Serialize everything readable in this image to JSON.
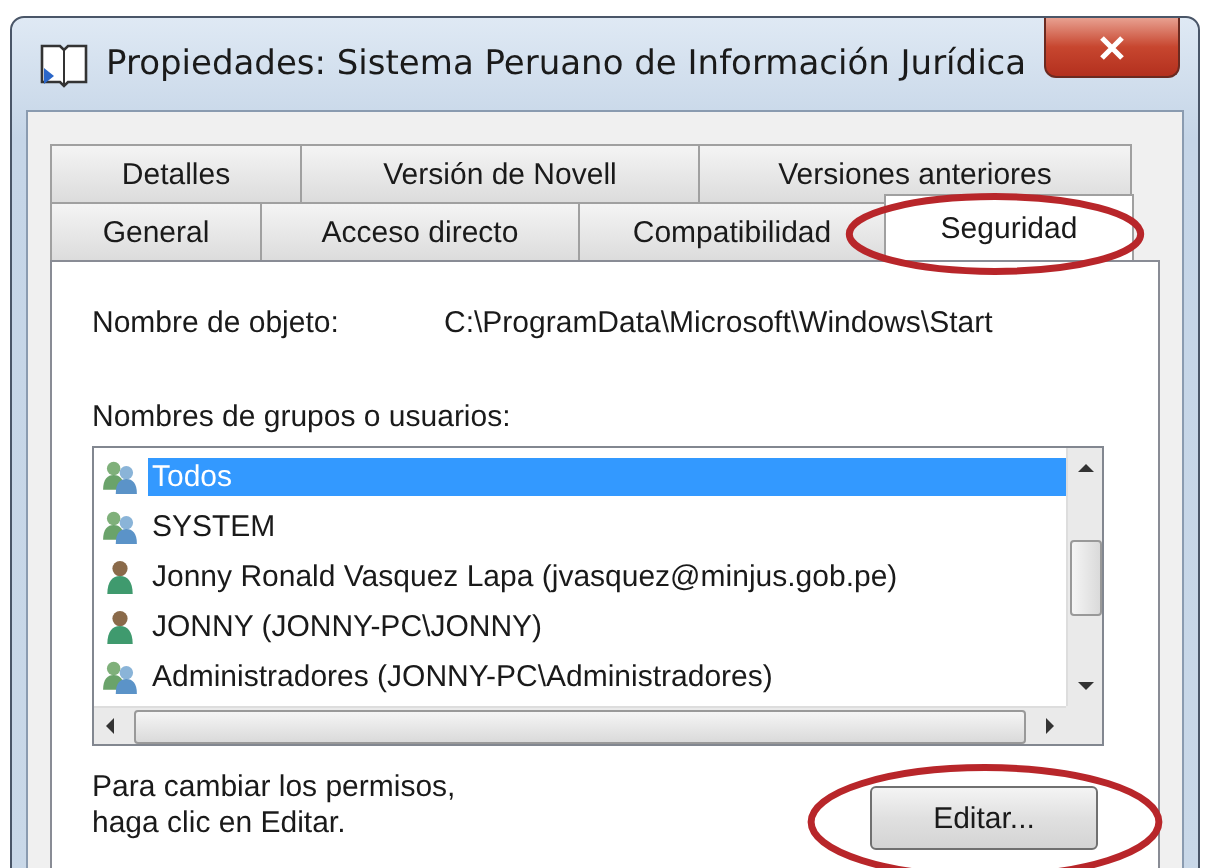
{
  "window": {
    "title": "Propiedades: Sistema Peruano de Información Jurídica"
  },
  "tab_rows": [
    [
      {
        "label": "Detalles",
        "selected": false,
        "circled": false
      },
      {
        "label": "Versión de Novell",
        "selected": false,
        "circled": false
      },
      {
        "label": "Versiones anteriores",
        "selected": false,
        "circled": false
      }
    ],
    [
      {
        "label": "General",
        "selected": false,
        "circled": false
      },
      {
        "label": "Acceso directo",
        "selected": false,
        "circled": false
      },
      {
        "label": "Compatibilidad",
        "selected": false,
        "circled": false
      },
      {
        "label": "Seguridad",
        "selected": true,
        "circled": true
      }
    ]
  ],
  "object_name": {
    "label": "Nombre de objeto:",
    "value": "C:\\ProgramData\\Microsoft\\Windows\\Start"
  },
  "users": {
    "label": "Nombres de grupos o usuarios:",
    "items": [
      {
        "name": "Todos",
        "kind": "group",
        "selected": true
      },
      {
        "name": "SYSTEM",
        "kind": "group",
        "selected": false
      },
      {
        "name": "Jonny Ronald Vasquez Lapa (jvasquez@minjus.gob.pe)",
        "kind": "user",
        "selected": false
      },
      {
        "name": "JONNY (JONNY-PC\\JONNY)",
        "kind": "user",
        "selected": false
      },
      {
        "name": "Administradores (JONNY-PC\\Administradores)",
        "kind": "group",
        "selected": false
      }
    ]
  },
  "hint": "Para cambiar los permisos,\nhaga clic en Editar.",
  "edit_button": {
    "label": "Editar...",
    "circled": true
  }
}
